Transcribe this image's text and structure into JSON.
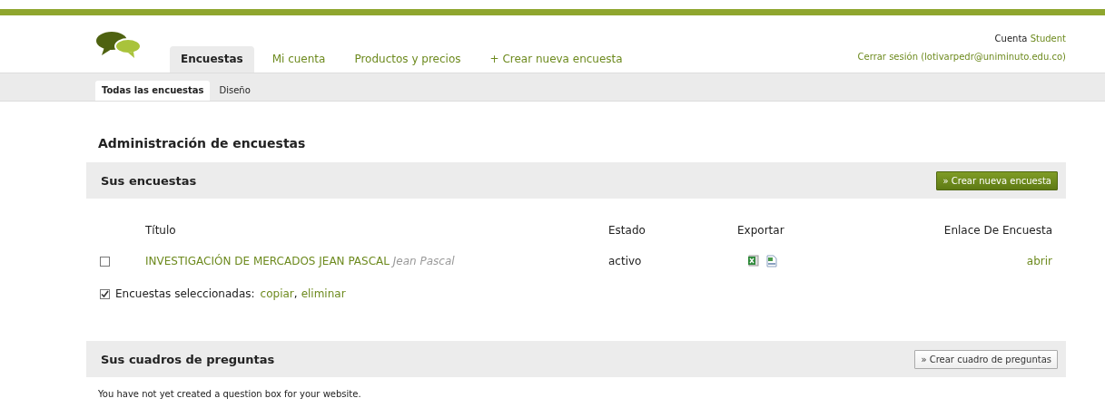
{
  "header": {
    "account_label": "Cuenta",
    "account_plan": "Student",
    "logout": "Cerrar sesión (lotivarpedr@uniminuto.edu.co)"
  },
  "tabs": [
    {
      "label": "Encuestas",
      "selected": true
    },
    {
      "label": "Mi cuenta",
      "selected": false
    },
    {
      "label": "Productos y precios",
      "selected": false
    },
    {
      "label": "+ Crear nueva encuesta",
      "selected": false
    }
  ],
  "subtabs": [
    {
      "label": "Todas las encuestas",
      "selected": true
    },
    {
      "label": "Diseño",
      "selected": false
    }
  ],
  "page_title": "Administración de encuestas",
  "surveys_panel": {
    "title": "Sus encuestas",
    "button": {
      "label": "» Crear nueva encuesta",
      "kind": "primary"
    },
    "columns": [
      "Título",
      "Estado",
      "Exportar",
      "Enlace De Encuesta"
    ],
    "rows": [
      {
        "title": "INVESTIGACIÓN DE MERCADOS JEAN PASCAL",
        "author": "Jean Pascal",
        "status": "activo",
        "link": "abrir",
        "checked": false
      }
    ],
    "bulk": {
      "checked": true,
      "label": "Encuestas seleccionadas:",
      "actions": [
        "copiar",
        "eliminar"
      ],
      "separator": ","
    }
  },
  "question_panel": {
    "title": "Sus cuadros de preguntas",
    "button": {
      "label": "» Crear cuadro de preguntas",
      "kind": "secondary"
    },
    "message": "You have not yet created a question box for your website."
  }
}
